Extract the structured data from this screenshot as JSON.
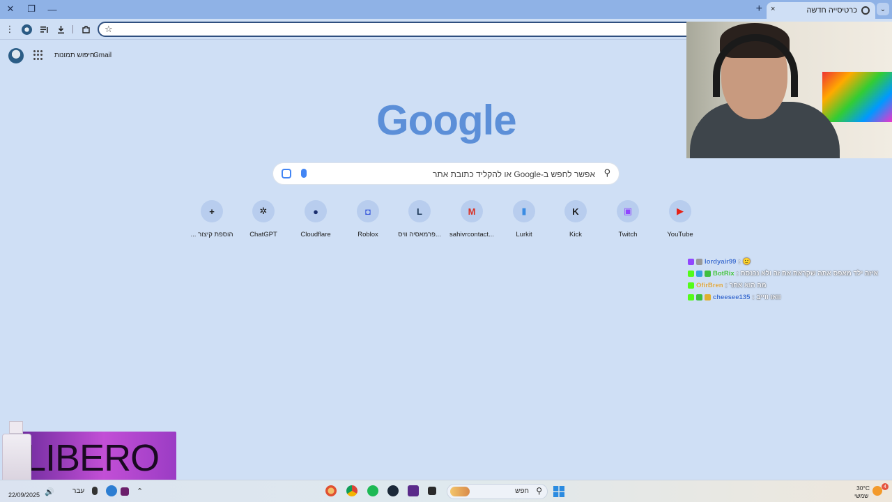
{
  "window": {
    "tab_title": "כרטיסייה חדשה",
    "tab_close": "×",
    "new_tab": "+",
    "minimize": "—",
    "restore": "❐",
    "close": "✕",
    "tab_menu": "⌄"
  },
  "toolbar": {
    "menu": "⋮",
    "bookmark_star": "☆"
  },
  "header": {
    "gmail": "Gmail",
    "images": "חיפוש תמונות"
  },
  "logo": "Google",
  "search": {
    "placeholder": "אפשר לחפש ב-Google או להקליד כתובת אתר"
  },
  "shortcuts": [
    {
      "label": "YouTube",
      "glyph": "▶",
      "color": "#e62117"
    },
    {
      "label": "Twitch",
      "glyph": "▣",
      "color": "#9146ff"
    },
    {
      "label": "Kick",
      "glyph": "K",
      "color": "#1b1b1b"
    },
    {
      "label": "Lurkit",
      "glyph": "▮",
      "color": "#3b8ce3"
    },
    {
      "label": "sahivrcontact...",
      "glyph": "M",
      "color": "#d93025"
    },
    {
      "label": "פרמאסיה וויס...",
      "glyph": "L",
      "color": "#1f3a5a"
    },
    {
      "label": "Roblox",
      "glyph": "◘",
      "color": "#3b5bdb"
    },
    {
      "label": "Cloudflare",
      "glyph": "●",
      "color": "#1a2e6e"
    },
    {
      "label": "ChatGPT",
      "glyph": "✲",
      "color": "#1f1f1f"
    },
    {
      "label": "... הוספת קיצור",
      "glyph": "+",
      "color": "#1f1f1f"
    }
  ],
  "chat": [
    {
      "user": "lordyair99",
      "msg": "🙂",
      "user_color": "#3e6fd0",
      "badges": [
        "#9146ff",
        "#999999"
      ]
    },
    {
      "user": "BotRix",
      "msg": "איזה ילד מאפס אתה שקראת את זה ולא נכנסת",
      "user_color": "#3fbf3f",
      "badges": [
        "#53fc18",
        "#3aa0e0",
        "#3fbf3f"
      ]
    },
    {
      "user": "OfirBren",
      "msg": "מה הוא אחר",
      "user_color": "#d9a441",
      "badges": [
        "#53fc18"
      ]
    },
    {
      "user": "cheesee135",
      "msg": "וואו ווייב",
      "user_color": "#3e6fd0",
      "badges": [
        "#53fc18",
        "#3fbf3f",
        "#e0b030"
      ]
    }
  ],
  "sponsor": {
    "brand": "LIBERO"
  },
  "taskbar": {
    "date": "22/09/2025",
    "lang": "עבר",
    "search_label": "חפש",
    "weather_temp": "30°C",
    "weather_desc": "שמשי",
    "notifications": "4"
  }
}
